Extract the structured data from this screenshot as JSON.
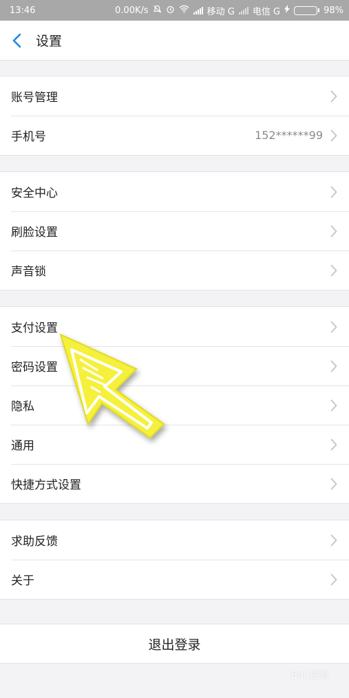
{
  "status_bar": {
    "time": "13:46",
    "network_speed": "0.00K/s",
    "carrier1": "移动 G",
    "carrier2": "电信 G",
    "battery": "98%",
    "battery_level": 0.98
  },
  "nav": {
    "title": "设置"
  },
  "groups": [
    {
      "items": [
        {
          "label": "账号管理",
          "value": ""
        },
        {
          "label": "手机号",
          "value": "152******99"
        }
      ]
    },
    {
      "items": [
        {
          "label": "安全中心",
          "value": ""
        },
        {
          "label": "刷脸设置",
          "value": ""
        },
        {
          "label": "声音锁",
          "value": ""
        }
      ]
    },
    {
      "items": [
        {
          "label": "支付设置",
          "value": ""
        },
        {
          "label": "密码设置",
          "value": ""
        },
        {
          "label": "隐私",
          "value": ""
        },
        {
          "label": "通用",
          "value": ""
        },
        {
          "label": "快捷方式设置",
          "value": ""
        }
      ]
    },
    {
      "items": [
        {
          "label": "求助反馈",
          "value": ""
        },
        {
          "label": "关于",
          "value": ""
        }
      ]
    }
  ],
  "logout": {
    "label": "退出登录"
  },
  "watermark": "Bai 经验",
  "colors": {
    "accent": "#1e88e5",
    "annotation_arrow": "#f5f03a",
    "battery_fill": "#3be44a"
  }
}
